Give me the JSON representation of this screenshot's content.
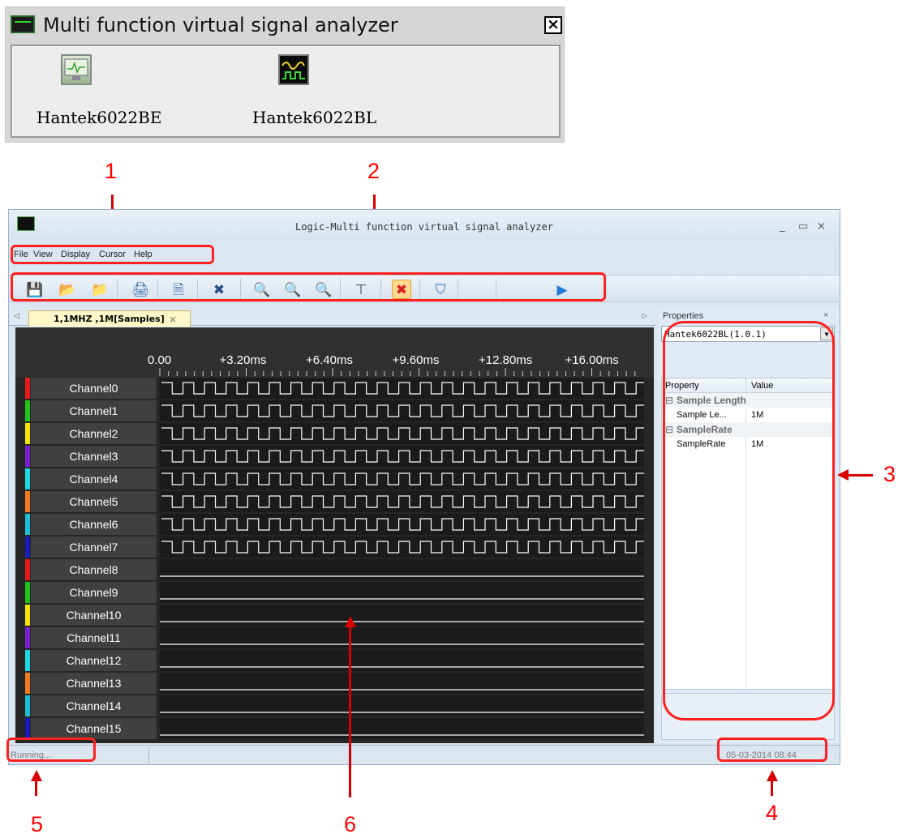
{
  "dialog": {
    "title": "Multi function virtual signal analyzer",
    "devices": [
      {
        "label": "Hantek6022BE",
        "icon": "computer-monitor-icon"
      },
      {
        "label": "Hantek6022BL",
        "icon": "logic-waveform-icon"
      }
    ]
  },
  "callouts": [
    "1",
    "2",
    "3",
    "4",
    "5",
    "6"
  ],
  "window": {
    "title": "Logic-Multi function virtual signal analyzer",
    "controls": [
      "_",
      "▭",
      "×"
    ]
  },
  "menu": [
    "File",
    "View",
    "Display",
    "Cursor",
    "Help"
  ],
  "toolbar": {
    "buttons": [
      {
        "name": "save-icon",
        "glyph": "💾",
        "color": "#1a6fd0"
      },
      {
        "name": "open-icon",
        "glyph": "📂",
        "color": "#1a6fd0"
      },
      {
        "name": "folder-icon",
        "glyph": "📁",
        "color": "#1a6fd0"
      },
      {
        "name": "print-icon",
        "glyph": "🖨",
        "color": "#2c5ea8"
      },
      {
        "name": "print-preview-icon",
        "glyph": "🗎",
        "color": "#2c5ea8"
      },
      {
        "name": "tools-icon",
        "glyph": "✖",
        "color": "#2a4c8a"
      },
      {
        "name": "zoom-in-icon",
        "glyph": "🔍",
        "color": "#2c5ea8"
      },
      {
        "name": "zoom-out-icon",
        "glyph": "🔍",
        "color": "#2c5ea8"
      },
      {
        "name": "zoom-fit-icon",
        "glyph": "🔍",
        "color": "#2c5ea8"
      },
      {
        "name": "trigger-icon",
        "glyph": "⊤",
        "color": "#444444"
      },
      {
        "name": "stop-icon",
        "glyph": "✖",
        "color": "#d92020"
      },
      {
        "name": "shield-icon",
        "glyph": "⛉",
        "color": "#2a6ec0"
      },
      {
        "name": "run-icon",
        "glyph": "▶",
        "color": "#1a7ad8"
      }
    ]
  },
  "tab": {
    "label": "1,1MHZ ,1M[Samples]",
    "close": "×",
    "scroll_left": "◁",
    "scroll_right": "▷"
  },
  "ruler": {
    "labels": [
      "0.00",
      "+3.20ms",
      "+6.40ms",
      "+9.60ms",
      "+12.80ms",
      "+16.00ms"
    ]
  },
  "channels": [
    {
      "name": "Channel0",
      "color": "#e41a1a",
      "active": true
    },
    {
      "name": "Channel1",
      "color": "#21c21a",
      "active": true
    },
    {
      "name": "Channel2",
      "color": "#f2e600",
      "active": true
    },
    {
      "name": "Channel3",
      "color": "#7a1ed2",
      "active": true
    },
    {
      "name": "Channel4",
      "color": "#1ed8e6",
      "active": true
    },
    {
      "name": "Channel5",
      "color": "#f07a1e",
      "active": true
    },
    {
      "name": "Channel6",
      "color": "#1ec0d8",
      "active": true
    },
    {
      "name": "Channel7",
      "color": "#1a1ab8",
      "active": true
    },
    {
      "name": "Channel8",
      "color": "#e41a1a",
      "active": false
    },
    {
      "name": "Channel9",
      "color": "#21c21a",
      "active": false
    },
    {
      "name": "Channel10",
      "color": "#f2e600",
      "active": false
    },
    {
      "name": "Channel11",
      "color": "#7a1ed2",
      "active": false
    },
    {
      "name": "Channel12",
      "color": "#1ed8e6",
      "active": false
    },
    {
      "name": "Channel13",
      "color": "#f07a1e",
      "active": false
    },
    {
      "name": "Channel14",
      "color": "#1ec0d8",
      "active": false
    },
    {
      "name": "Channel15",
      "color": "#1a1ab8",
      "active": false
    }
  ],
  "properties": {
    "title": "Properties",
    "close": "×",
    "device": "Hantek6022BL(1.0.1)",
    "header": {
      "property": "Property",
      "value": "Value"
    },
    "groups": [
      {
        "name": "Sample Length",
        "rows": [
          {
            "key": "Sample Le...",
            "value": "1M"
          }
        ]
      },
      {
        "name": "SampleRate",
        "rows": [
          {
            "key": "SampleRate",
            "value": "1M"
          }
        ]
      }
    ]
  },
  "status": {
    "left": "Running...",
    "time": "05-03-2014 08:44"
  }
}
